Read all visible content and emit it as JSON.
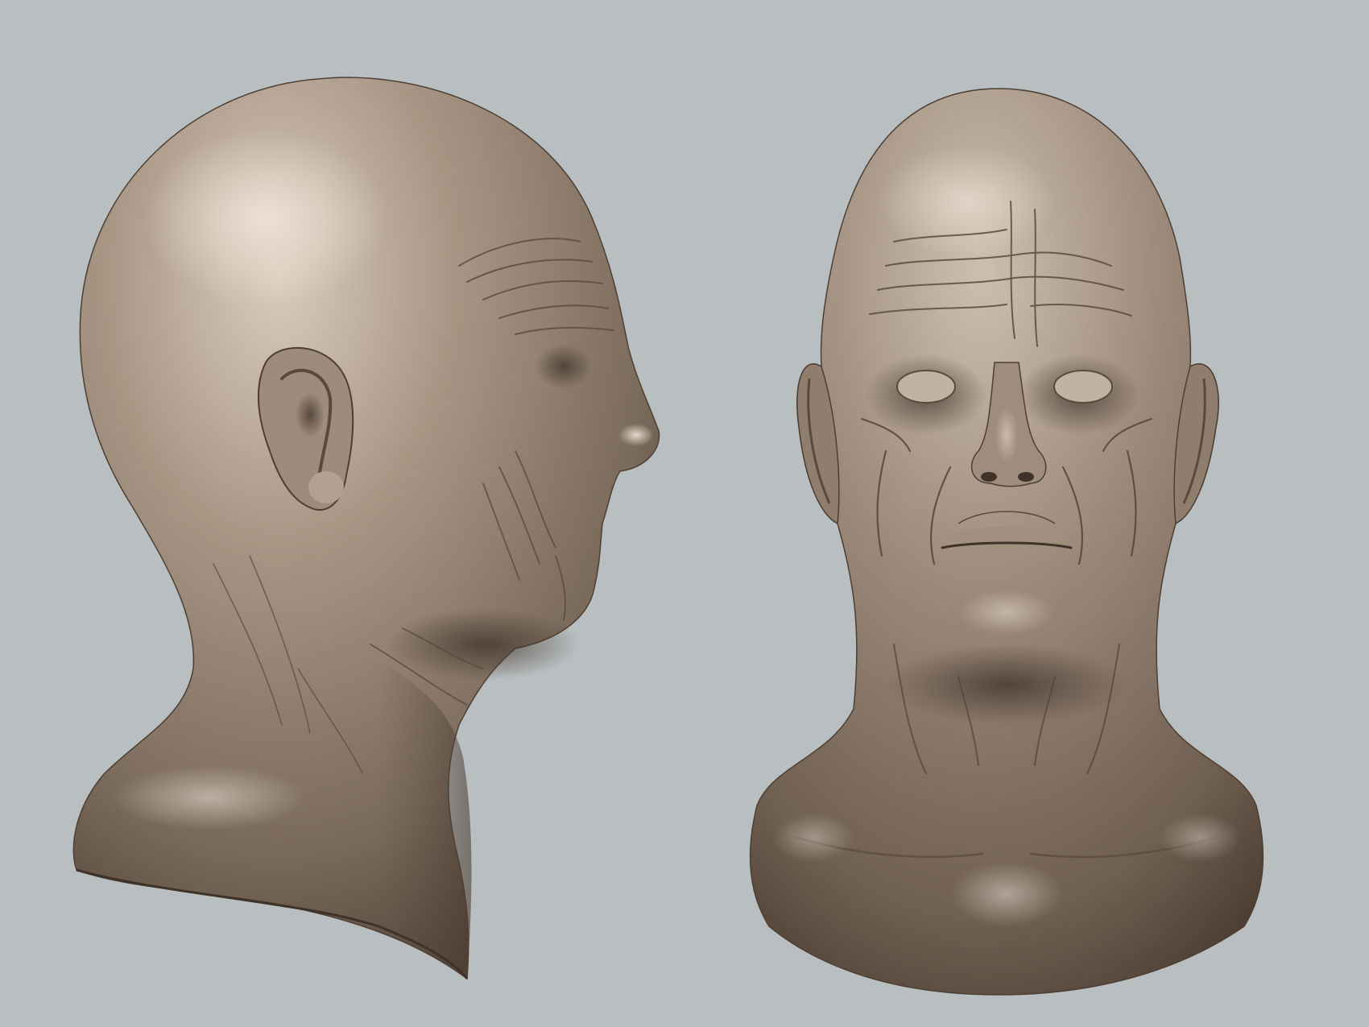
{
  "scene": {
    "background_color": "#b9bfc1",
    "material_color": "#8e7e6e",
    "views": [
      {
        "name": "side-profile-view"
      },
      {
        "name": "front-view"
      }
    ]
  }
}
